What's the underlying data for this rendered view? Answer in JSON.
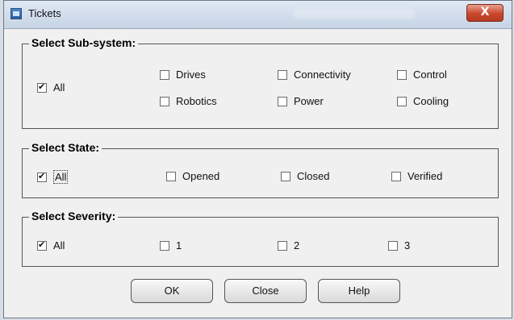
{
  "window": {
    "title": "Tickets",
    "close_glyph": "X"
  },
  "subsystem": {
    "title": "Select Sub-system:",
    "all": {
      "label": "All",
      "checked": true
    },
    "options": [
      {
        "label": "Drives",
        "checked": false
      },
      {
        "label": "Connectivity",
        "checked": false
      },
      {
        "label": "Control",
        "checked": false
      },
      {
        "label": "Robotics",
        "checked": false
      },
      {
        "label": "Power",
        "checked": false
      },
      {
        "label": "Cooling",
        "checked": false
      }
    ]
  },
  "state": {
    "title": "Select State:",
    "all": {
      "label": "All",
      "checked": true
    },
    "options": [
      {
        "label": "Opened",
        "checked": false
      },
      {
        "label": "Closed",
        "checked": false
      },
      {
        "label": "Verified",
        "checked": false
      }
    ]
  },
  "severity": {
    "title": "Select Severity:",
    "all": {
      "label": "All",
      "checked": true
    },
    "options": [
      {
        "label": "1",
        "checked": false
      },
      {
        "label": "2",
        "checked": false
      },
      {
        "label": "3",
        "checked": false
      }
    ]
  },
  "buttons": {
    "ok": "OK",
    "close": "Close",
    "help": "Help"
  }
}
